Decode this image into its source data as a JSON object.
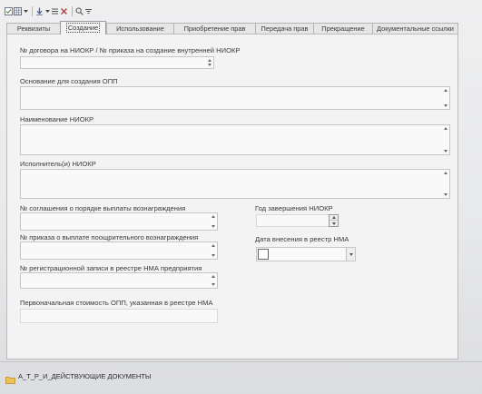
{
  "toolbar": {
    "icons": [
      "checklist-icon",
      "table-icon",
      "dropdown-arrow-icon",
      "arrow-down-icon",
      "dropdown-arrow-icon",
      "list-icon",
      "delete-icon",
      "search-icon",
      "sort-icon"
    ]
  },
  "tabs": [
    {
      "label": "Реквизиты",
      "active": false
    },
    {
      "label": "Создание",
      "active": true
    },
    {
      "label": "Использование",
      "active": false
    },
    {
      "label": "Приобретение прав",
      "active": false
    },
    {
      "label": "Передача прав",
      "active": false
    },
    {
      "label": "Прекращение",
      "active": false
    },
    {
      "label": "Документальные ссылки",
      "active": false
    }
  ],
  "form": {
    "contract_number": {
      "label": "№ договора на НИОКР / № приказа на создание внутренней НИОКР",
      "value": ""
    },
    "basis": {
      "label": "Основание для создания ОПП",
      "value": ""
    },
    "rnd_name": {
      "label": "Наименование НИОКР",
      "value": ""
    },
    "executors": {
      "label": "Исполнитель(и) НИОКР",
      "value": ""
    },
    "agreement_number": {
      "label": "№ соглашения о порядке выплаты вознаграждения",
      "value": ""
    },
    "completion_year": {
      "label": "Год завершения НИОКР",
      "value": ""
    },
    "order_number": {
      "label": "№ приказа о выплате поощрительного вознаграждения",
      "value": ""
    },
    "registry_date": {
      "label": "Дата внесения в реестр НМА",
      "value": ""
    },
    "registration_record": {
      "label": "№ регистрационной записи в реестре НМА предприятия",
      "value": ""
    },
    "initial_cost": {
      "label": "Первоначальная стоимость ОПП, указанная в реестре НМА",
      "value": ""
    }
  },
  "status_bar": {
    "folder_label": "А_Т_Р_И_ДЕЙСТВУЮЩИЕ ДОКУМЕНТЫ"
  },
  "colors": {
    "background": "#e8e9eb",
    "panel": "#f3f3f3",
    "border": "#bcbcbc",
    "text": "#3a3a3a",
    "folder": "#efc257"
  }
}
